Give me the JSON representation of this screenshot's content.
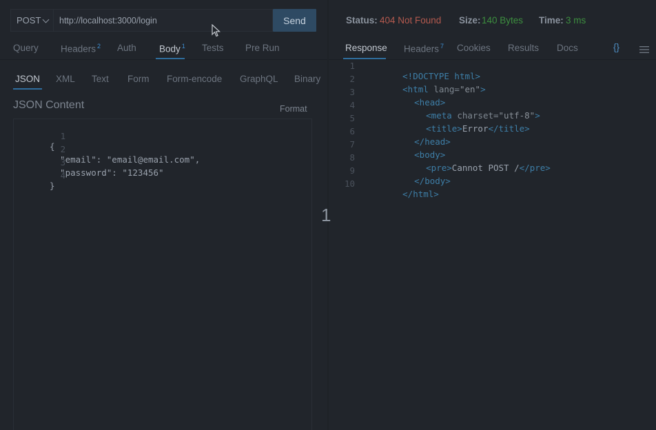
{
  "request": {
    "method": "POST",
    "url": "http://localhost:3000/login",
    "send_label": "Send",
    "tabs": [
      {
        "label": "Query",
        "badge": ""
      },
      {
        "label": "Headers",
        "badge": "2"
      },
      {
        "label": "Auth",
        "badge": ""
      },
      {
        "label": "Body",
        "badge": "1"
      },
      {
        "label": "Tests",
        "badge": ""
      },
      {
        "label": "Pre Run",
        "badge": ""
      }
    ],
    "body_tabs": [
      "JSON",
      "XML",
      "Text",
      "Form",
      "Form-encode",
      "GraphQL",
      "Binary"
    ],
    "content_title": "JSON Content",
    "format_label": "Format",
    "body_lines": [
      {
        "n": "1",
        "text": "{"
      },
      {
        "n": "2",
        "text": "  \"email\": \"email@email.com\","
      },
      {
        "n": "3",
        "text": "  \"password\": \"123456\""
      },
      {
        "n": "4",
        "text": "}"
      }
    ]
  },
  "response": {
    "status_label": "Status:",
    "status_value": "404 Not Found",
    "size_label": "Size:",
    "size_value": "140 Bytes",
    "time_label": "Time:",
    "time_value": "3 ms",
    "tabs": [
      {
        "label": "Response",
        "badge": ""
      },
      {
        "label": "Headers",
        "badge": "7"
      },
      {
        "label": "Cookies",
        "badge": ""
      },
      {
        "label": "Results",
        "badge": ""
      },
      {
        "label": "Docs",
        "badge": ""
      }
    ],
    "braces_icon": "{}",
    "line_numbers": [
      "1",
      "2",
      "3",
      "4",
      "5",
      "6",
      "7",
      "8",
      "9",
      "10"
    ],
    "lines": {
      "l1": "<!DOCTYPE html>",
      "l2_tag": "<html",
      "l2_attr": " lang=",
      "l2_val": "\"en\"",
      "l2_end": ">",
      "l3": "<head>",
      "l4_tag": "<meta",
      "l4_attr": " charset=",
      "l4_val": "\"utf-8\"",
      "l4_end": ">",
      "l5_open": "<title>",
      "l5_text": "Error",
      "l5_close": "</title>",
      "l6": "</head>",
      "l7": "<body>",
      "l8_open": "<pre>",
      "l8_text": "Cannot POST /",
      "l8_close": "</pre>",
      "l9": "</body>",
      "l10": "</html>"
    }
  },
  "splitter_number": "1",
  "colors": {
    "background": "#21252b",
    "accent": "#2f6e9e",
    "error": "#b55a4f",
    "success": "#3d8f3f"
  },
  "icons": [
    "chevron-down-icon",
    "mouse-cursor-icon",
    "braces-icon",
    "menu-icon"
  ]
}
